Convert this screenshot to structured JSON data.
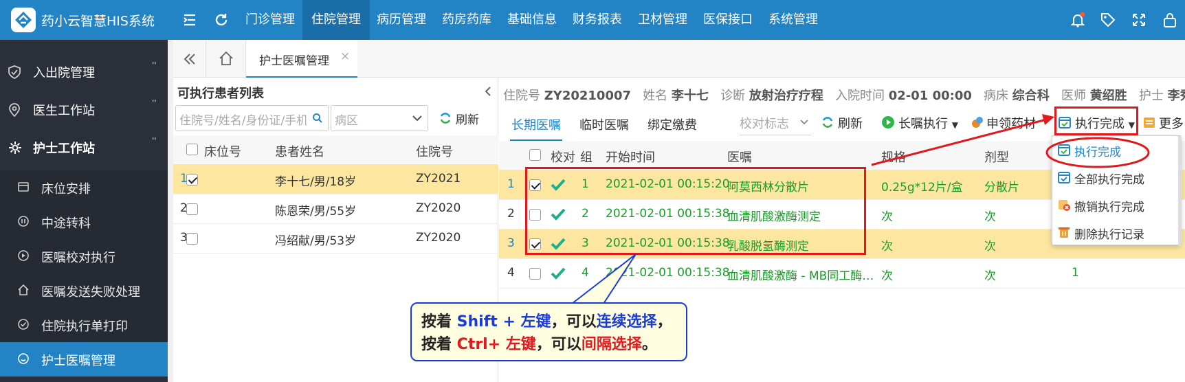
{
  "app": {
    "title": "药小云智慧HIS系统"
  },
  "nav": [
    "门诊管理",
    "住院管理",
    "病历管理",
    "药房药库",
    "基础信息",
    "财务报表",
    "卫材管理",
    "医保接口",
    "系统管理"
  ],
  "sidebar": {
    "groups": [
      {
        "label": "入出院管理",
        "mark": "''"
      },
      {
        "label": "医生工作站",
        "mark": "''"
      },
      {
        "label": "护士工作站",
        "mark": "''"
      }
    ],
    "items": [
      "床位安排",
      "中途转科",
      "医嘱校对执行",
      "医嘱发送失败处理",
      "住院执行单打印",
      "护士医嘱管理"
    ]
  },
  "tab": {
    "label": "护士医嘱管理",
    "close": "×"
  },
  "left": {
    "title": "可执行患者列表",
    "search_placeholder": "住院号/姓名/身份证/手机",
    "ward_placeholder": "病区",
    "refresh": "刷新",
    "headers": [
      "床位号",
      "患者姓名",
      "住院号"
    ],
    "rows": [
      {
        "idx": "1",
        "name": "李十七/男/18岁",
        "no": "ZY2021"
      },
      {
        "idx": "2",
        "name": "陈恩荣/男/55岁",
        "no": "ZY2020"
      },
      {
        "idx": "3",
        "name": "冯绍献/男/53岁",
        "no": "ZY2020"
      }
    ]
  },
  "info": {
    "no_label": "住院号",
    "no": "ZY20210007",
    "name_label": "姓名",
    "name": "李十七",
    "diag_label": "诊断",
    "diag": "放射治疗疗程",
    "time_label": "入院时间",
    "time": "02-01 00:00",
    "bed_label": "病床",
    "bed": "综合科",
    "doctor_label": "医师",
    "doctor": "黄绍胜",
    "nurse_label": "护士",
    "nurse": "李秀琼"
  },
  "right": {
    "tabs": [
      "长期医嘱",
      "临时医嘱",
      "绑定缴费"
    ],
    "verify_select": "校对标志",
    "refresh": "刷新",
    "exec_long": "长嘱执行",
    "apply_drug": "申领药材",
    "exec_done": "执行完成",
    "more": "更多",
    "headers": [
      "校对",
      "组",
      "开始时间",
      "医嘱",
      "规格",
      "剂型"
    ],
    "rows": [
      {
        "idx": "1",
        "group": "1",
        "time": "2021-02-01 00:15:20",
        "order": "阿莫西林分散片",
        "spec": "0.25g*12片/盒",
        "form": "分散片",
        "extra": ""
      },
      {
        "idx": "2",
        "group": "2",
        "time": "2021-02-01 00:15:38",
        "order": "血清肌酸激酶测定",
        "spec": "次",
        "form": "次",
        "extra": ""
      },
      {
        "idx": "3",
        "group": "3",
        "time": "2021-02-01 00:15:38",
        "order": "乳酸脱氢酶测定",
        "spec": "次",
        "form": "次",
        "extra": ""
      },
      {
        "idx": "4",
        "group": "4",
        "time": "2021-02-01 00:15:38",
        "order": "血清肌酸激酶 - MB同工酶…",
        "spec": "次",
        "form": "次",
        "extra": "1"
      }
    ]
  },
  "menu": [
    "执行完成",
    "全部执行完成",
    "撤销执行完成",
    "删除执行记录"
  ],
  "callout": {
    "l1_a": "按着 ",
    "l1_b": "Shift + 左键",
    "l1_c": "，可以",
    "l1_d": "连续选择",
    "l1_e": "，",
    "l2_a": "按着 ",
    "l2_b": "Ctrl+ 左键",
    "l2_c": "，可以",
    "l2_d": "间隔选择",
    "l2_e": "。"
  },
  "colors": {
    "brand": "#2384c5",
    "sidebar": "#2b2f3a",
    "highlight": "#fde7a0",
    "annotation": "#e0191e",
    "green": "#1a9b2a"
  }
}
